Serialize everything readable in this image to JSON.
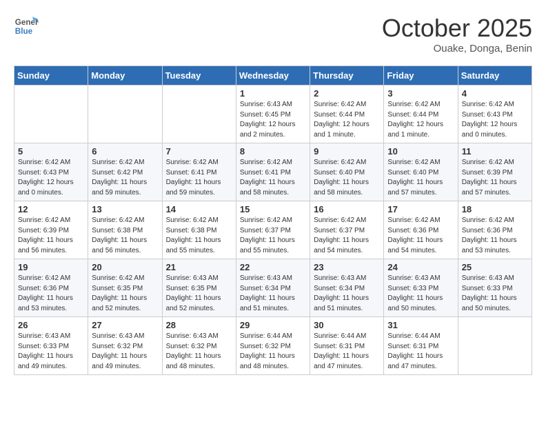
{
  "header": {
    "logo_general": "General",
    "logo_blue": "Blue",
    "month": "October 2025",
    "location": "Ouake, Donga, Benin"
  },
  "weekdays": [
    "Sunday",
    "Monday",
    "Tuesday",
    "Wednesday",
    "Thursday",
    "Friday",
    "Saturday"
  ],
  "weeks": [
    [
      {
        "day": "",
        "info": ""
      },
      {
        "day": "",
        "info": ""
      },
      {
        "day": "",
        "info": ""
      },
      {
        "day": "1",
        "info": "Sunrise: 6:43 AM\nSunset: 6:45 PM\nDaylight: 12 hours and 2 minutes."
      },
      {
        "day": "2",
        "info": "Sunrise: 6:42 AM\nSunset: 6:44 PM\nDaylight: 12 hours and 1 minute."
      },
      {
        "day": "3",
        "info": "Sunrise: 6:42 AM\nSunset: 6:44 PM\nDaylight: 12 hours and 1 minute."
      },
      {
        "day": "4",
        "info": "Sunrise: 6:42 AM\nSunset: 6:43 PM\nDaylight: 12 hours and 0 minutes."
      }
    ],
    [
      {
        "day": "5",
        "info": "Sunrise: 6:42 AM\nSunset: 6:43 PM\nDaylight: 12 hours and 0 minutes."
      },
      {
        "day": "6",
        "info": "Sunrise: 6:42 AM\nSunset: 6:42 PM\nDaylight: 11 hours and 59 minutes."
      },
      {
        "day": "7",
        "info": "Sunrise: 6:42 AM\nSunset: 6:41 PM\nDaylight: 11 hours and 59 minutes."
      },
      {
        "day": "8",
        "info": "Sunrise: 6:42 AM\nSunset: 6:41 PM\nDaylight: 11 hours and 58 minutes."
      },
      {
        "day": "9",
        "info": "Sunrise: 6:42 AM\nSunset: 6:40 PM\nDaylight: 11 hours and 58 minutes."
      },
      {
        "day": "10",
        "info": "Sunrise: 6:42 AM\nSunset: 6:40 PM\nDaylight: 11 hours and 57 minutes."
      },
      {
        "day": "11",
        "info": "Sunrise: 6:42 AM\nSunset: 6:39 PM\nDaylight: 11 hours and 57 minutes."
      }
    ],
    [
      {
        "day": "12",
        "info": "Sunrise: 6:42 AM\nSunset: 6:39 PM\nDaylight: 11 hours and 56 minutes."
      },
      {
        "day": "13",
        "info": "Sunrise: 6:42 AM\nSunset: 6:38 PM\nDaylight: 11 hours and 56 minutes."
      },
      {
        "day": "14",
        "info": "Sunrise: 6:42 AM\nSunset: 6:38 PM\nDaylight: 11 hours and 55 minutes."
      },
      {
        "day": "15",
        "info": "Sunrise: 6:42 AM\nSunset: 6:37 PM\nDaylight: 11 hours and 55 minutes."
      },
      {
        "day": "16",
        "info": "Sunrise: 6:42 AM\nSunset: 6:37 PM\nDaylight: 11 hours and 54 minutes."
      },
      {
        "day": "17",
        "info": "Sunrise: 6:42 AM\nSunset: 6:36 PM\nDaylight: 11 hours and 54 minutes."
      },
      {
        "day": "18",
        "info": "Sunrise: 6:42 AM\nSunset: 6:36 PM\nDaylight: 11 hours and 53 minutes."
      }
    ],
    [
      {
        "day": "19",
        "info": "Sunrise: 6:42 AM\nSunset: 6:36 PM\nDaylight: 11 hours and 53 minutes."
      },
      {
        "day": "20",
        "info": "Sunrise: 6:42 AM\nSunset: 6:35 PM\nDaylight: 11 hours and 52 minutes."
      },
      {
        "day": "21",
        "info": "Sunrise: 6:43 AM\nSunset: 6:35 PM\nDaylight: 11 hours and 52 minutes."
      },
      {
        "day": "22",
        "info": "Sunrise: 6:43 AM\nSunset: 6:34 PM\nDaylight: 11 hours and 51 minutes."
      },
      {
        "day": "23",
        "info": "Sunrise: 6:43 AM\nSunset: 6:34 PM\nDaylight: 11 hours and 51 minutes."
      },
      {
        "day": "24",
        "info": "Sunrise: 6:43 AM\nSunset: 6:33 PM\nDaylight: 11 hours and 50 minutes."
      },
      {
        "day": "25",
        "info": "Sunrise: 6:43 AM\nSunset: 6:33 PM\nDaylight: 11 hours and 50 minutes."
      }
    ],
    [
      {
        "day": "26",
        "info": "Sunrise: 6:43 AM\nSunset: 6:33 PM\nDaylight: 11 hours and 49 minutes."
      },
      {
        "day": "27",
        "info": "Sunrise: 6:43 AM\nSunset: 6:32 PM\nDaylight: 11 hours and 49 minutes."
      },
      {
        "day": "28",
        "info": "Sunrise: 6:43 AM\nSunset: 6:32 PM\nDaylight: 11 hours and 48 minutes."
      },
      {
        "day": "29",
        "info": "Sunrise: 6:44 AM\nSunset: 6:32 PM\nDaylight: 11 hours and 48 minutes."
      },
      {
        "day": "30",
        "info": "Sunrise: 6:44 AM\nSunset: 6:31 PM\nDaylight: 11 hours and 47 minutes."
      },
      {
        "day": "31",
        "info": "Sunrise: 6:44 AM\nSunset: 6:31 PM\nDaylight: 11 hours and 47 minutes."
      },
      {
        "day": "",
        "info": ""
      }
    ]
  ]
}
